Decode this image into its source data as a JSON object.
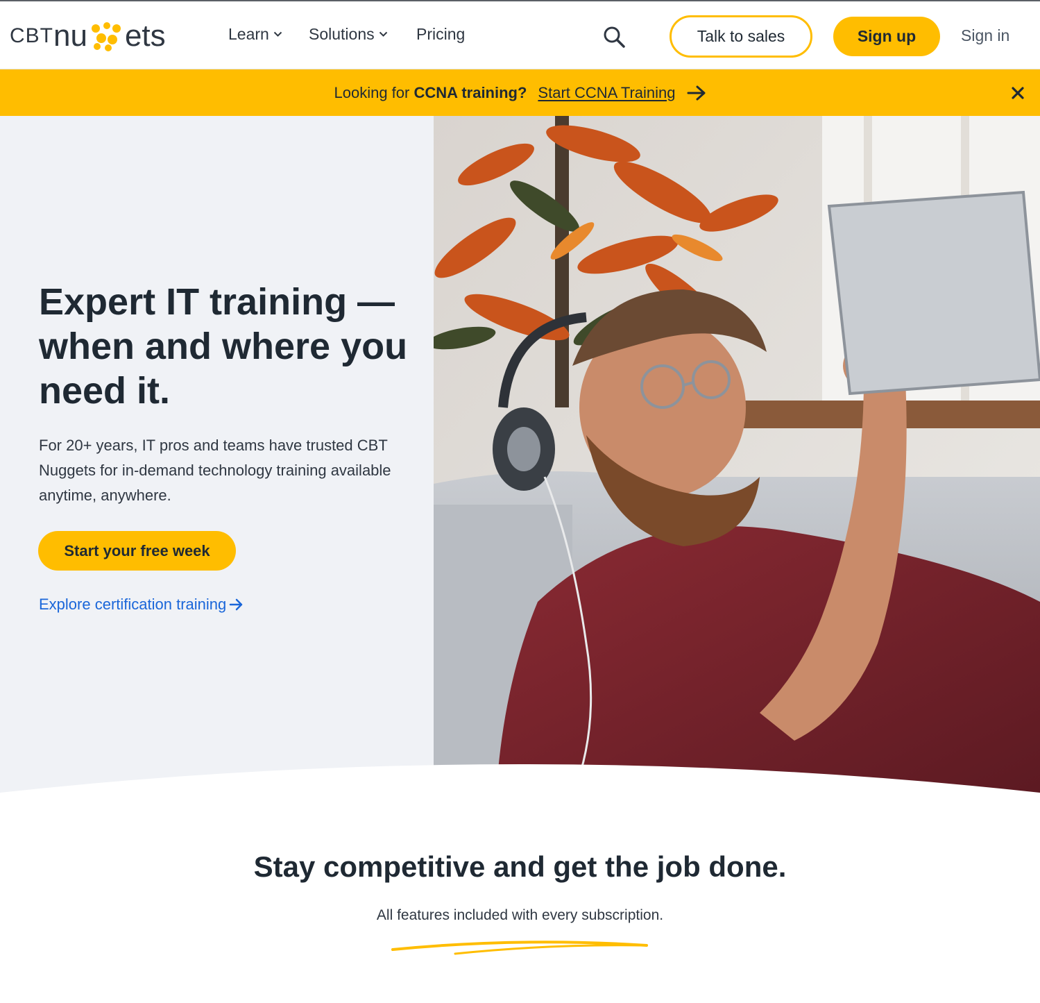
{
  "header": {
    "logo": {
      "text_cbt": "CBT",
      "text_nu": "nu",
      "text_ets": "ets",
      "alt": "CBTnuggets"
    },
    "nav": [
      {
        "label": "Learn",
        "has_dropdown": true
      },
      {
        "label": "Solutions",
        "has_dropdown": true
      },
      {
        "label": "Pricing",
        "has_dropdown": false
      }
    ],
    "search_icon": "search-icon",
    "talk_to_sales_label": "Talk to sales",
    "sign_up_label": "Sign up",
    "sign_in_label": "Sign in"
  },
  "banner": {
    "prefix": "Looking for",
    "bold": "CCNA training?",
    "link_label": "Start CCNA Training",
    "arrow_icon": "arrow-right-icon",
    "close_icon": "close-icon"
  },
  "hero": {
    "title_line1": "Expert IT training —",
    "title_line2": "when and where you",
    "title_line3": "need it.",
    "subtitle": "For 20+ years, IT pros and teams have trusted CBT Nuggets for in-demand technology training available anytime, anywhere.",
    "cta_label": "Start your free week",
    "explore_label": "Explore certification training",
    "explore_icon": "arrow-right-icon"
  },
  "features": {
    "title": "Stay competitive and get the job done.",
    "subtitle": "All features included with every subscription."
  },
  "colors": {
    "brand_yellow": "#ffbd00",
    "text_dark": "#1f2933",
    "link_blue": "#1a66d9",
    "hero_bg": "#f0f2f6"
  }
}
